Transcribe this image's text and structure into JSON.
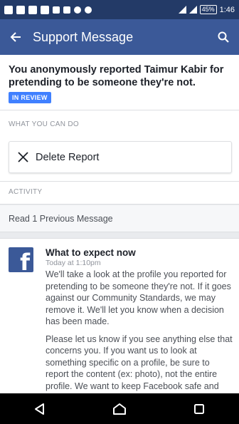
{
  "status_bar": {
    "battery": "45%",
    "time": "1:46"
  },
  "appbar": {
    "title": "Support Message",
    "back_icon": "arrow-left-icon",
    "search_icon": "search-icon"
  },
  "report": {
    "title": "You anonymously reported Taimur Kabir for pretending to be someone they're not.",
    "status_badge": "IN REVIEW"
  },
  "what_you_can_do": {
    "label": "WHAT YOU CAN DO",
    "delete_label": "Delete Report"
  },
  "activity": {
    "label": "ACTIVITY",
    "previous_messages": "Read 1 Previous Message"
  },
  "message": {
    "title": "What to expect now",
    "time": "Today at 1:10pm",
    "paragraph1": "We'll take a look at the profile you reported for pretending to be someone they're not. If it goes against our Community Standards, we may remove it. We'll let you know when a decision has been made.",
    "paragraph2": "Please let us know if you see anything else that concerns you. If you want us to look at something specific on a profile, be sure to report the content (ex: photo), not the entire profile. We want to keep Facebook safe and"
  },
  "colors": {
    "brand": "#3b5998",
    "status_bar": "#233a67",
    "badge": "#4080ff"
  }
}
